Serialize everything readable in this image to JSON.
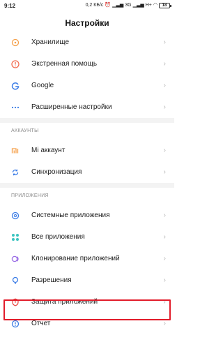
{
  "status_bar": {
    "time": "9:12",
    "speed": "0,2 КБ/с",
    "network": "3G",
    "signal_extra": "H+",
    "battery": "18"
  },
  "header": {
    "title": "Настройки"
  },
  "items_top": [
    {
      "label": "Хранилище",
      "icon": "storage-icon"
    },
    {
      "label": "Экстренная помощь",
      "icon": "emergency-icon"
    },
    {
      "label": "Google",
      "icon": "google-icon"
    },
    {
      "label": "Расширенные настройки",
      "icon": "more-dots-icon"
    }
  ],
  "section_accounts": {
    "title": "АККАУНТЫ",
    "items": [
      {
        "label": "Mi аккаунт",
        "icon": "mi-icon"
      },
      {
        "label": "Синхронизация",
        "icon": "sync-icon"
      }
    ]
  },
  "section_apps": {
    "title": "ПРИЛОЖЕНИЯ",
    "items": [
      {
        "label": "Системные приложения",
        "icon": "system-apps-icon"
      },
      {
        "label": "Все приложения",
        "icon": "all-apps-icon"
      },
      {
        "label": "Клонирование приложений",
        "icon": "clone-apps-icon"
      },
      {
        "label": "Разрешения",
        "icon": "permissions-icon"
      },
      {
        "label": "Защита приложений",
        "icon": "app-lock-icon"
      },
      {
        "label": "Отчет",
        "icon": "report-icon"
      }
    ]
  },
  "colors": {
    "highlight": "#e21c2a",
    "accent_orange": "#f5a04a"
  }
}
